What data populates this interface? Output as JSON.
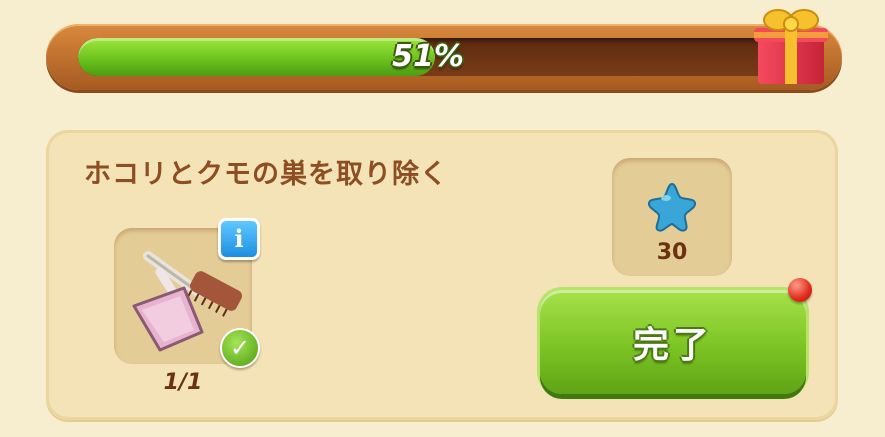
{
  "progress": {
    "fraction": 0.51,
    "label": "51%",
    "reward_icon": "gift-box-icon"
  },
  "task": {
    "title": "ホコリとクモの巣を取り除く",
    "item": {
      "icon": "dustpan-brush-icon",
      "count_label": "1/1",
      "info_icon": "info-icon",
      "done_icon": "check-icon"
    },
    "reward": {
      "icon": "blue-star-icon",
      "amount": "30"
    },
    "complete_button": {
      "label": "完了",
      "notification": true
    }
  },
  "colors": {
    "background": "#f7eed0",
    "bar_frame": "#c57434",
    "bar_fill": "#6cc41d",
    "title_text": "#8c4e22",
    "button_green": "#7cc424",
    "star_blue": "#3aa6d8"
  }
}
